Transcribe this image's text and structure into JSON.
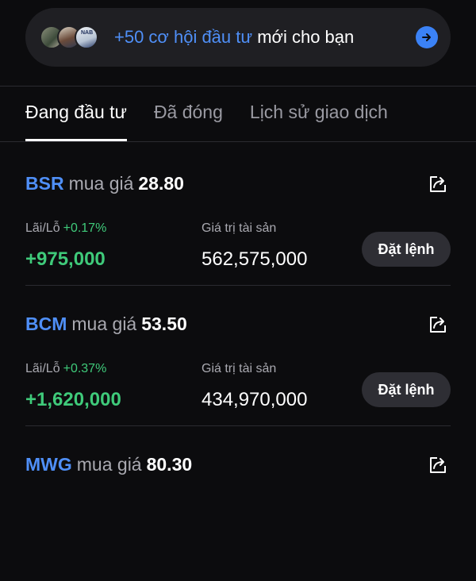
{
  "promo": {
    "highlight": "+50 cơ hội đầu tư",
    "rest": " mới cho bạn",
    "avatar3_text": "NAB",
    "arrow_icon": "arrow-right-icon"
  },
  "tabs": [
    {
      "label": "Đang đầu tư",
      "active": true
    },
    {
      "label": "Đã đóng",
      "active": false
    },
    {
      "label": "Lịch sử giao dịch",
      "active": false
    }
  ],
  "holdings": [
    {
      "symbol": "BSR",
      "buy_label": "mua giá",
      "price": "28.80",
      "pl_label": "Lãi/Lỗ",
      "pl_pct": "+0.17%",
      "pl_value": "+975,000",
      "asset_label": "Giá trị tài sản",
      "asset_value": "562,575,000",
      "order_label": "Đặt lệnh"
    },
    {
      "symbol": "BCM",
      "buy_label": "mua giá",
      "price": "53.50",
      "pl_label": "Lãi/Lỗ",
      "pl_pct": "+0.37%",
      "pl_value": "+1,620,000",
      "asset_label": "Giá trị tài sản",
      "asset_value": "434,970,000",
      "order_label": "Đặt lệnh"
    },
    {
      "symbol": "MWG",
      "buy_label": "mua giá",
      "price": "80.30"
    }
  ],
  "colors": {
    "accent": "#4f8ff7",
    "profit": "#3fca7a",
    "background": "#0c0c0e"
  }
}
